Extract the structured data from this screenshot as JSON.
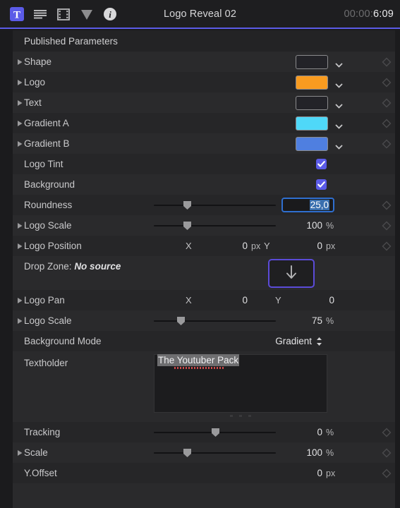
{
  "toolbar": {
    "icons": [
      {
        "name": "text-tool-icon",
        "glyph": "T"
      },
      {
        "name": "text-lines-icon"
      },
      {
        "name": "film-strip-icon"
      },
      {
        "name": "filter-triangle-icon"
      },
      {
        "name": "info-icon"
      }
    ],
    "title": "Logo Reveal 02",
    "timecode_dim": "00:00:",
    "timecode_lit": "6:09",
    "accent": "#5b5be8"
  },
  "section": {
    "title": "Published Parameters"
  },
  "colors": {
    "shape_swatch": "#232328",
    "logo_swatch": "#f89b20",
    "text_swatch": "#232328",
    "gradient_a_swatch": "#4fd8f8",
    "gradient_b_swatch": "#4f7fe0",
    "checkbox": "#5b5be8",
    "dropzone_border": "#5b4bd8",
    "focus_border": "#2f6fd0",
    "spellcheck": "#d04a4a"
  },
  "rows": {
    "shape": {
      "label": "Shape"
    },
    "logo": {
      "label": "Logo"
    },
    "text": {
      "label": "Text"
    },
    "gradient_a": {
      "label": "Gradient A"
    },
    "gradient_b": {
      "label": "Gradient B"
    },
    "logo_tint": {
      "label": "Logo Tint",
      "checked": "true"
    },
    "background": {
      "label": "Background",
      "checked": "true"
    },
    "roundness": {
      "label": "Roundness",
      "value": "25,0",
      "slider_pct": "27"
    },
    "logo_scale_1": {
      "label": "Logo Scale",
      "value": "100",
      "unit": "%",
      "slider_pct": "27"
    },
    "logo_position": {
      "label": "Logo Position",
      "x_axis": "X",
      "x_value": "0",
      "x_unit": "px",
      "y_axis": "Y",
      "y_value": "0",
      "y_unit": "px"
    },
    "drop_zone": {
      "label_prefix": "Drop Zone:",
      "label_value": "No source",
      "button_icon": "down-arrow-icon"
    },
    "logo_pan": {
      "label": "Logo Pan",
      "x_axis": "X",
      "x_value": "0",
      "y_axis": "Y",
      "y_value": "0"
    },
    "logo_scale_2": {
      "label": "Logo Scale",
      "value": "75",
      "unit": "%",
      "slider_pct": "22"
    },
    "background_mode": {
      "label": "Background Mode",
      "value": "Gradient"
    },
    "textholder": {
      "label": "Textholder",
      "value": "The Youtuber Pack"
    },
    "tracking": {
      "label": "Tracking",
      "value": "0",
      "unit": "%",
      "slider_pct": "50"
    },
    "scale": {
      "label": "Scale",
      "value": "100",
      "unit": "%",
      "slider_pct": "27"
    },
    "y_offset": {
      "label": "Y.Offset",
      "value": "0",
      "unit": "px"
    }
  }
}
